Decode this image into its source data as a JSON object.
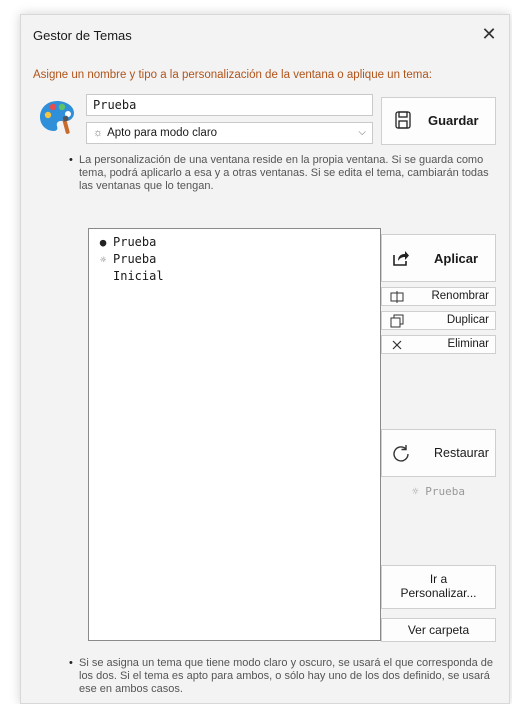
{
  "window": {
    "title": "Gestor de Temas"
  },
  "instruction": "Asigne un nombre y tipo a la personalización de la ventana o aplique un tema:",
  "name_field": {
    "value": "Prueba"
  },
  "mode_select": {
    "selected": "Apto para modo claro",
    "icon": "sun-icon"
  },
  "buttons": {
    "guardar": "Guardar",
    "aplicar": "Aplicar",
    "renombrar": "Renombrar",
    "duplicar": "Duplicar",
    "eliminar": "Eliminar",
    "restaurar": "Restaurar",
    "ir_line1": "Ir a",
    "ir_line2": "Personalizar...",
    "ver_carpeta": "Ver carpeta"
  },
  "note_top": "La personalización de una ventana reside en la propia ventana. Si se guarda como tema, podrá aplicarlo a esa y a otras ventanas. Si se edita el tema, cambiarán todas las ventanas que lo tengan.",
  "themes": [
    {
      "mark": "●",
      "name": "Prueba",
      "type": "dark"
    },
    {
      "mark": "☼",
      "name": "Prueba",
      "type": "light"
    },
    {
      "mark": "",
      "name": "Inicial",
      "type": "none"
    }
  ],
  "restore_hint": "☼ Prueba",
  "note_bottom": "Si se asigna un tema que tiene modo claro y oscuro, se usará el que corresponda de los dos. Si el tema es apto para ambos, o sólo hay uno de los dos definido, se usará ese en ambos casos.",
  "colors": {
    "instruction": "#b0541a",
    "dialog_bg": "#f3f3f3"
  }
}
